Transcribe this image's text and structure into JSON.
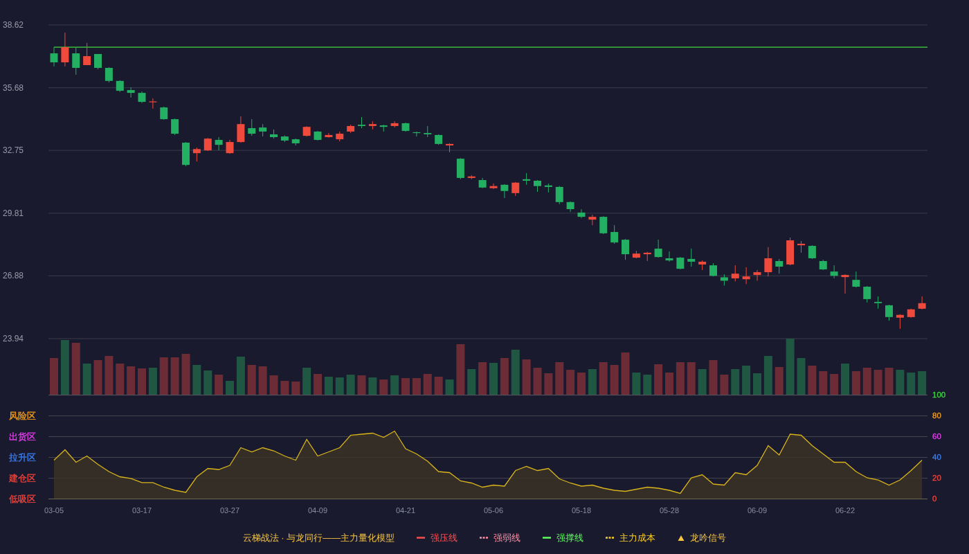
{
  "price_chart": {
    "chart_data": {
      "type": "candlestick",
      "grid": true,
      "ylim": [
        23.94,
        38.62
      ],
      "yticks": [
        {
          "value": 38.62,
          "label": "38.62"
        },
        {
          "value": 35.68,
          "label": "35.68"
        },
        {
          "value": 32.75,
          "label": "32.75"
        },
        {
          "value": 29.81,
          "label": "29.81"
        },
        {
          "value": 26.88,
          "label": "26.88"
        },
        {
          "value": 23.94,
          "label": "23.94"
        }
      ],
      "ohlc": [
        [
          37.29,
          37.58,
          36.68,
          36.87
        ],
        [
          36.87,
          38.26,
          36.68,
          37.58
        ],
        [
          37.29,
          37.58,
          36.29,
          36.61
        ],
        [
          36.74,
          37.78,
          36.74,
          37.16
        ],
        [
          37.26,
          37.26,
          36.55,
          36.61
        ],
        [
          36.61,
          36.64,
          35.93,
          36.0
        ],
        [
          36.0,
          36.03,
          35.48,
          35.54
        ],
        [
          35.57,
          35.7,
          35.22,
          35.44
        ],
        [
          35.44,
          35.51,
          34.97,
          35.02
        ],
        [
          35.0,
          35.18,
          34.7,
          35.04
        ],
        [
          34.76,
          34.8,
          34.18,
          34.21
        ],
        [
          34.21,
          34.24,
          33.47,
          33.53
        ],
        [
          33.11,
          33.14,
          32.01,
          32.07
        ],
        [
          32.62,
          32.88,
          32.23,
          32.81
        ],
        [
          32.75,
          33.33,
          32.72,
          33.3
        ],
        [
          33.24,
          33.37,
          32.75,
          33.01
        ],
        [
          32.62,
          33.24,
          32.59,
          33.14
        ],
        [
          33.14,
          34.34,
          33.11,
          33.98
        ],
        [
          33.79,
          34.21,
          33.43,
          33.53
        ],
        [
          33.82,
          33.98,
          33.4,
          33.63
        ],
        [
          33.5,
          33.73,
          33.3,
          33.37
        ],
        [
          33.4,
          33.45,
          33.14,
          33.21
        ],
        [
          33.27,
          33.3,
          32.98,
          33.08
        ],
        [
          33.43,
          33.88,
          33.4,
          33.85
        ],
        [
          33.63,
          33.66,
          33.21,
          33.24
        ],
        [
          33.37,
          33.56,
          33.34,
          33.47
        ],
        [
          33.27,
          33.63,
          33.17,
          33.53
        ],
        [
          33.63,
          33.95,
          33.56,
          33.89
        ],
        [
          33.95,
          34.31,
          33.79,
          33.89
        ],
        [
          33.89,
          34.11,
          33.73,
          33.98
        ],
        [
          33.92,
          33.95,
          33.63,
          33.85
        ],
        [
          33.89,
          34.11,
          33.82,
          34.02
        ],
        [
          34.02,
          34.05,
          33.63,
          33.66
        ],
        [
          33.6,
          33.63,
          33.4,
          33.56
        ],
        [
          33.56,
          33.89,
          33.37,
          33.5
        ],
        [
          33.47,
          33.5,
          33.01,
          33.05
        ],
        [
          32.98,
          33.08,
          32.66,
          33.05
        ],
        [
          32.36,
          32.39,
          31.4,
          31.46
        ],
        [
          31.46,
          31.59,
          31.4,
          31.53
        ],
        [
          31.36,
          31.46,
          30.98,
          31.01
        ],
        [
          30.98,
          31.2,
          30.94,
          31.08
        ],
        [
          31.14,
          31.17,
          30.52,
          30.85
        ],
        [
          30.75,
          31.27,
          30.62,
          31.24
        ],
        [
          31.4,
          31.69,
          31.14,
          31.33
        ],
        [
          31.33,
          31.36,
          30.81,
          31.08
        ],
        [
          31.11,
          31.2,
          30.78,
          31.04
        ],
        [
          31.04,
          31.08,
          30.23,
          30.33
        ],
        [
          30.33,
          30.36,
          29.87,
          30.0
        ],
        [
          29.84,
          30.0,
          29.58,
          29.64
        ],
        [
          29.51,
          29.74,
          29.25,
          29.64
        ],
        [
          29.64,
          29.67,
          28.83,
          28.87
        ],
        [
          28.93,
          29.25,
          28.38,
          28.44
        ],
        [
          28.57,
          28.6,
          27.63,
          27.89
        ],
        [
          27.73,
          28.05,
          27.7,
          27.92
        ],
        [
          27.89,
          28.0,
          27.57,
          27.96
        ],
        [
          28.15,
          28.57,
          27.73,
          27.76
        ],
        [
          27.7,
          28.02,
          27.54,
          27.6
        ],
        [
          27.73,
          27.76,
          27.18,
          27.21
        ],
        [
          27.67,
          28.15,
          27.31,
          27.54
        ],
        [
          27.41,
          27.6,
          27.15,
          27.54
        ],
        [
          27.37,
          27.47,
          26.85,
          26.88
        ],
        [
          26.81,
          26.95,
          26.42,
          26.65
        ],
        [
          26.76,
          27.37,
          26.62,
          26.98
        ],
        [
          26.72,
          27.28,
          26.49,
          26.85
        ],
        [
          26.92,
          27.15,
          26.65,
          27.05
        ],
        [
          27.05,
          28.22,
          26.85,
          27.7
        ],
        [
          27.57,
          27.67,
          26.98,
          27.31
        ],
        [
          27.41,
          28.67,
          27.37,
          28.54
        ],
        [
          28.31,
          28.51,
          27.96,
          28.38
        ],
        [
          28.28,
          28.31,
          27.67,
          27.7
        ],
        [
          27.57,
          27.63,
          27.15,
          27.18
        ],
        [
          27.08,
          27.37,
          26.76,
          26.88
        ],
        [
          26.82,
          26.95,
          26.05,
          26.92
        ],
        [
          26.69,
          27.08,
          26.33,
          26.37
        ],
        [
          26.37,
          26.4,
          25.63,
          25.79
        ],
        [
          25.66,
          25.92,
          25.34,
          25.6
        ],
        [
          25.5,
          25.53,
          24.78,
          24.95
        ],
        [
          24.92,
          25.08,
          24.4,
          25.05
        ],
        [
          24.95,
          25.34,
          24.92,
          25.31
        ],
        [
          25.34,
          25.92,
          25.31,
          25.6
        ]
      ],
      "ref_lines": [
        {
          "axis": "y",
          "value": 37.58,
          "color": "#3fd93f"
        }
      ]
    }
  },
  "indicator": {
    "zones": [
      {
        "label": "风险区",
        "color": "#f7a21b"
      },
      {
        "label": "出货区",
        "color": "#e83ff0"
      },
      {
        "label": "拉升区",
        "color": "#3b82f6"
      },
      {
        "label": "建仓区",
        "color": "#f2453d"
      },
      {
        "label": "低吸区",
        "color": "#f2453d"
      }
    ],
    "top_tick": {
      "color": "#3fd93f"
    },
    "chart_data": {
      "type": "area",
      "grid": true,
      "ylim": [
        0,
        100
      ],
      "yticks": [
        100,
        80,
        60,
        40,
        20,
        0
      ],
      "series": [
        {
          "color": "#d9b51a",
          "values": [
            37,
            47,
            35,
            41,
            33,
            26,
            21,
            19.5,
            15.5,
            15.5,
            11,
            8,
            6,
            21,
            29,
            28,
            32,
            49,
            45,
            49,
            46,
            41,
            37,
            57,
            41,
            45,
            49,
            61,
            62,
            63,
            59,
            65,
            48,
            43,
            36,
            26,
            25,
            17,
            15,
            11,
            13,
            12,
            27,
            31,
            27,
            29,
            19,
            15,
            12,
            13,
            10,
            8,
            7,
            9,
            11,
            10,
            8,
            5,
            20,
            23,
            14,
            13,
            25,
            23,
            32,
            51,
            42,
            62,
            61,
            51,
            43,
            35,
            35,
            26,
            20,
            18,
            13,
            18,
            27,
            37
          ]
        }
      ]
    },
    "date_axis": [
      "03-05",
      "03-17",
      "03-27",
      "04-09",
      "04-21",
      "05-06",
      "05-18",
      "05-28",
      "06-09",
      "06-22"
    ]
  },
  "legend": {
    "heading": {
      "text": "云梯战法 · 与龙同行——主力量化模型",
      "color": "#f5c542"
    },
    "items": [
      {
        "label": "强压线",
        "kind": "solid",
        "color": "#ff4d4f"
      },
      {
        "label": "强弱线",
        "kind": "dashed",
        "color": "#ff8fa3"
      },
      {
        "label": "强撑线",
        "kind": "solid",
        "color": "#5cff5c"
      },
      {
        "label": "主力成本",
        "kind": "dashed",
        "color": "#ffd21f"
      },
      {
        "label": "龙吟信号",
        "kind": "triangle",
        "color": "#f5c542"
      }
    ]
  }
}
